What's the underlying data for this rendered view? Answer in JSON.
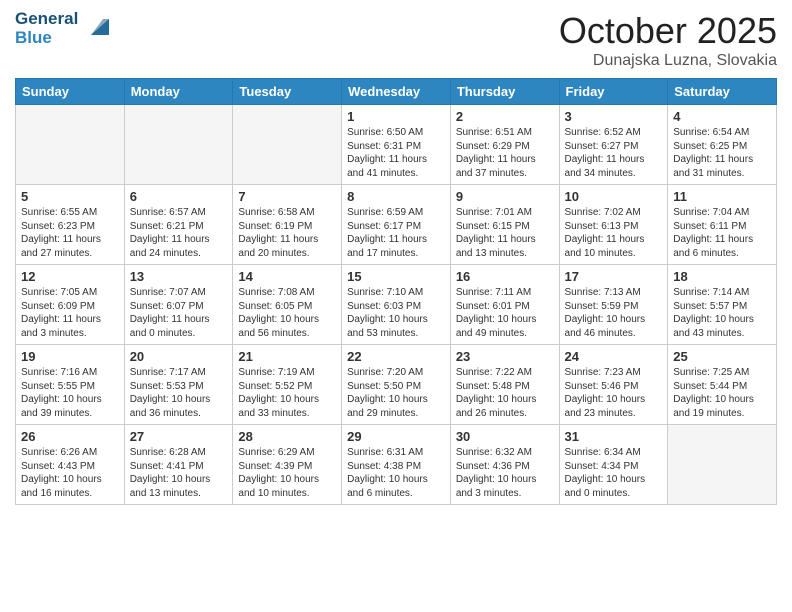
{
  "header": {
    "logo_line1": "General",
    "logo_line2": "Blue",
    "month": "October 2025",
    "location": "Dunajska Luzna, Slovakia"
  },
  "days_of_week": [
    "Sunday",
    "Monday",
    "Tuesday",
    "Wednesday",
    "Thursday",
    "Friday",
    "Saturday"
  ],
  "weeks": [
    [
      {
        "day": "",
        "info": ""
      },
      {
        "day": "",
        "info": ""
      },
      {
        "day": "",
        "info": ""
      },
      {
        "day": "1",
        "info": "Sunrise: 6:50 AM\nSunset: 6:31 PM\nDaylight: 11 hours\nand 41 minutes."
      },
      {
        "day": "2",
        "info": "Sunrise: 6:51 AM\nSunset: 6:29 PM\nDaylight: 11 hours\nand 37 minutes."
      },
      {
        "day": "3",
        "info": "Sunrise: 6:52 AM\nSunset: 6:27 PM\nDaylight: 11 hours\nand 34 minutes."
      },
      {
        "day": "4",
        "info": "Sunrise: 6:54 AM\nSunset: 6:25 PM\nDaylight: 11 hours\nand 31 minutes."
      }
    ],
    [
      {
        "day": "5",
        "info": "Sunrise: 6:55 AM\nSunset: 6:23 PM\nDaylight: 11 hours\nand 27 minutes."
      },
      {
        "day": "6",
        "info": "Sunrise: 6:57 AM\nSunset: 6:21 PM\nDaylight: 11 hours\nand 24 minutes."
      },
      {
        "day": "7",
        "info": "Sunrise: 6:58 AM\nSunset: 6:19 PM\nDaylight: 11 hours\nand 20 minutes."
      },
      {
        "day": "8",
        "info": "Sunrise: 6:59 AM\nSunset: 6:17 PM\nDaylight: 11 hours\nand 17 minutes."
      },
      {
        "day": "9",
        "info": "Sunrise: 7:01 AM\nSunset: 6:15 PM\nDaylight: 11 hours\nand 13 minutes."
      },
      {
        "day": "10",
        "info": "Sunrise: 7:02 AM\nSunset: 6:13 PM\nDaylight: 11 hours\nand 10 minutes."
      },
      {
        "day": "11",
        "info": "Sunrise: 7:04 AM\nSunset: 6:11 PM\nDaylight: 11 hours\nand 6 minutes."
      }
    ],
    [
      {
        "day": "12",
        "info": "Sunrise: 7:05 AM\nSunset: 6:09 PM\nDaylight: 11 hours\nand 3 minutes."
      },
      {
        "day": "13",
        "info": "Sunrise: 7:07 AM\nSunset: 6:07 PM\nDaylight: 11 hours\nand 0 minutes."
      },
      {
        "day": "14",
        "info": "Sunrise: 7:08 AM\nSunset: 6:05 PM\nDaylight: 10 hours\nand 56 minutes."
      },
      {
        "day": "15",
        "info": "Sunrise: 7:10 AM\nSunset: 6:03 PM\nDaylight: 10 hours\nand 53 minutes."
      },
      {
        "day": "16",
        "info": "Sunrise: 7:11 AM\nSunset: 6:01 PM\nDaylight: 10 hours\nand 49 minutes."
      },
      {
        "day": "17",
        "info": "Sunrise: 7:13 AM\nSunset: 5:59 PM\nDaylight: 10 hours\nand 46 minutes."
      },
      {
        "day": "18",
        "info": "Sunrise: 7:14 AM\nSunset: 5:57 PM\nDaylight: 10 hours\nand 43 minutes."
      }
    ],
    [
      {
        "day": "19",
        "info": "Sunrise: 7:16 AM\nSunset: 5:55 PM\nDaylight: 10 hours\nand 39 minutes."
      },
      {
        "day": "20",
        "info": "Sunrise: 7:17 AM\nSunset: 5:53 PM\nDaylight: 10 hours\nand 36 minutes."
      },
      {
        "day": "21",
        "info": "Sunrise: 7:19 AM\nSunset: 5:52 PM\nDaylight: 10 hours\nand 33 minutes."
      },
      {
        "day": "22",
        "info": "Sunrise: 7:20 AM\nSunset: 5:50 PM\nDaylight: 10 hours\nand 29 minutes."
      },
      {
        "day": "23",
        "info": "Sunrise: 7:22 AM\nSunset: 5:48 PM\nDaylight: 10 hours\nand 26 minutes."
      },
      {
        "day": "24",
        "info": "Sunrise: 7:23 AM\nSunset: 5:46 PM\nDaylight: 10 hours\nand 23 minutes."
      },
      {
        "day": "25",
        "info": "Sunrise: 7:25 AM\nSunset: 5:44 PM\nDaylight: 10 hours\nand 19 minutes."
      }
    ],
    [
      {
        "day": "26",
        "info": "Sunrise: 6:26 AM\nSunset: 4:43 PM\nDaylight: 10 hours\nand 16 minutes."
      },
      {
        "day": "27",
        "info": "Sunrise: 6:28 AM\nSunset: 4:41 PM\nDaylight: 10 hours\nand 13 minutes."
      },
      {
        "day": "28",
        "info": "Sunrise: 6:29 AM\nSunset: 4:39 PM\nDaylight: 10 hours\nand 10 minutes."
      },
      {
        "day": "29",
        "info": "Sunrise: 6:31 AM\nSunset: 4:38 PM\nDaylight: 10 hours\nand 6 minutes."
      },
      {
        "day": "30",
        "info": "Sunrise: 6:32 AM\nSunset: 4:36 PM\nDaylight: 10 hours\nand 3 minutes."
      },
      {
        "day": "31",
        "info": "Sunrise: 6:34 AM\nSunset: 4:34 PM\nDaylight: 10 hours\nand 0 minutes."
      },
      {
        "day": "",
        "info": ""
      }
    ]
  ]
}
